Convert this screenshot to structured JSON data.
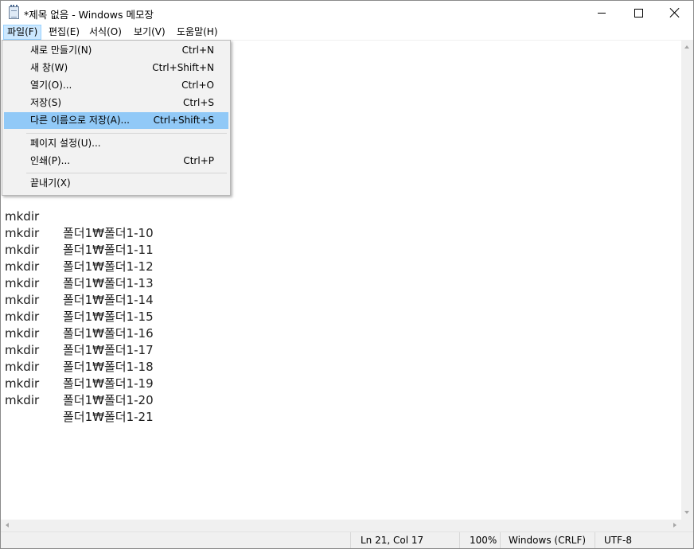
{
  "window": {
    "title": "*제목 없음 - Windows 메모장"
  },
  "menubar": [
    {
      "label": "파일(F)"
    },
    {
      "label": "편집(E)"
    },
    {
      "label": "서식(O)"
    },
    {
      "label": "보기(V)"
    },
    {
      "label": "도움말(H)"
    }
  ],
  "file_menu": {
    "items": [
      {
        "label": "새로 만들기(N)",
        "shortcut": "Ctrl+N"
      },
      {
        "label": "새 창(W)",
        "shortcut": "Ctrl+Shift+N"
      },
      {
        "label": "열기(O)...",
        "shortcut": "Ctrl+O"
      },
      {
        "label": "저장(S)",
        "shortcut": "Ctrl+S"
      },
      {
        "label": "다른 이름으로 저장(A)...",
        "shortcut": "Ctrl+Shift+S"
      },
      {
        "label": "페이지 설정(U)...",
        "shortcut": ""
      },
      {
        "label": "인쇄(P)...",
        "shortcut": "Ctrl+P"
      },
      {
        "label": "끝내기(X)",
        "shortcut": ""
      }
    ],
    "highlighted": "다른 이름으로 저장(A)..."
  },
  "editor": {
    "lines": [
      {
        "cmd": "mkdir",
        "arg": "폴더1₩폴더1-10"
      },
      {
        "cmd": "mkdir",
        "arg": "폴더1₩폴더1-11"
      },
      {
        "cmd": "mkdir",
        "arg": "폴더1₩폴더1-12"
      },
      {
        "cmd": "mkdir",
        "arg": "폴더1₩폴더1-13"
      },
      {
        "cmd": "mkdir",
        "arg": "폴더1₩폴더1-14"
      },
      {
        "cmd": "mkdir",
        "arg": "폴더1₩폴더1-15"
      },
      {
        "cmd": "mkdir",
        "arg": "폴더1₩폴더1-16"
      },
      {
        "cmd": "mkdir",
        "arg": "폴더1₩폴더1-17"
      },
      {
        "cmd": "mkdir",
        "arg": "폴더1₩폴더1-18"
      },
      {
        "cmd": "mkdir",
        "arg": "폴더1₩폴더1-19"
      },
      {
        "cmd": "mkdir",
        "arg": "폴더1₩폴더1-20"
      },
      {
        "cmd": "mkdir",
        "arg": "폴더1₩폴더1-21"
      }
    ]
  },
  "statusbar": {
    "position": "Ln 21, Col 17",
    "zoom": "100%",
    "line_ending": "Windows (CRLF)",
    "encoding": "UTF-8"
  },
  "colors": {
    "menu_highlight": "#91c9f7",
    "menubar_active": "#cce8ff",
    "statusbar_bg": "#f0f0f0"
  }
}
